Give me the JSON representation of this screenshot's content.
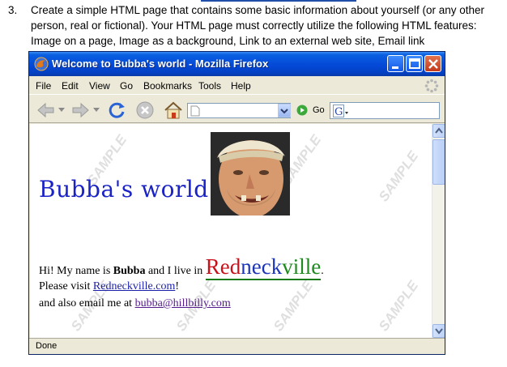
{
  "assignment": {
    "number": "3.",
    "text": "Create a simple HTML page that contains some basic information about yourself (or any other person, real or fictional). Your HTML page must correctly utilize the following HTML features:  Image on a page, Image as a background, Link to an external web site, Email link"
  },
  "window": {
    "title": "Welcome to Bubba's world - Mozilla Firefox",
    "menu": [
      "File",
      "Edit",
      "View",
      "Go",
      "Bookmarks",
      "Tools",
      "Help"
    ],
    "go_label": "Go",
    "search_engine": "G",
    "status": "Done"
  },
  "page": {
    "heading": "Bubba's world",
    "watermark": "SAMPLE",
    "intro_prefix": "Hi! My name is ",
    "name": "Bubba",
    "intro_suffix": " and I live in ",
    "brand": {
      "red": "Red",
      "blue": "neck",
      "green": "ville",
      "period": "."
    },
    "visit_prefix": "Please visit ",
    "site_link": "Redneckville.com",
    "visit_suffix": "!",
    "email_prefix": "and also email me at ",
    "email_link": "bubba@hillbilly.com"
  },
  "colors": {
    "title_bar": "#0449d8",
    "chrome": "#ece9d8",
    "heading": "#1a23c6",
    "brand_red": "#c8121b",
    "brand_blue": "#1b34b8",
    "brand_green": "#1e8a1e",
    "link": "#1a1fa8"
  },
  "icons": [
    "firefox-icon",
    "minimize-icon",
    "maximize-icon",
    "close-icon",
    "throbber-icon",
    "back-icon",
    "forward-icon",
    "reload-icon",
    "stop-icon",
    "home-icon",
    "page-icon",
    "dropdown-icon",
    "go-icon",
    "google-icon"
  ]
}
